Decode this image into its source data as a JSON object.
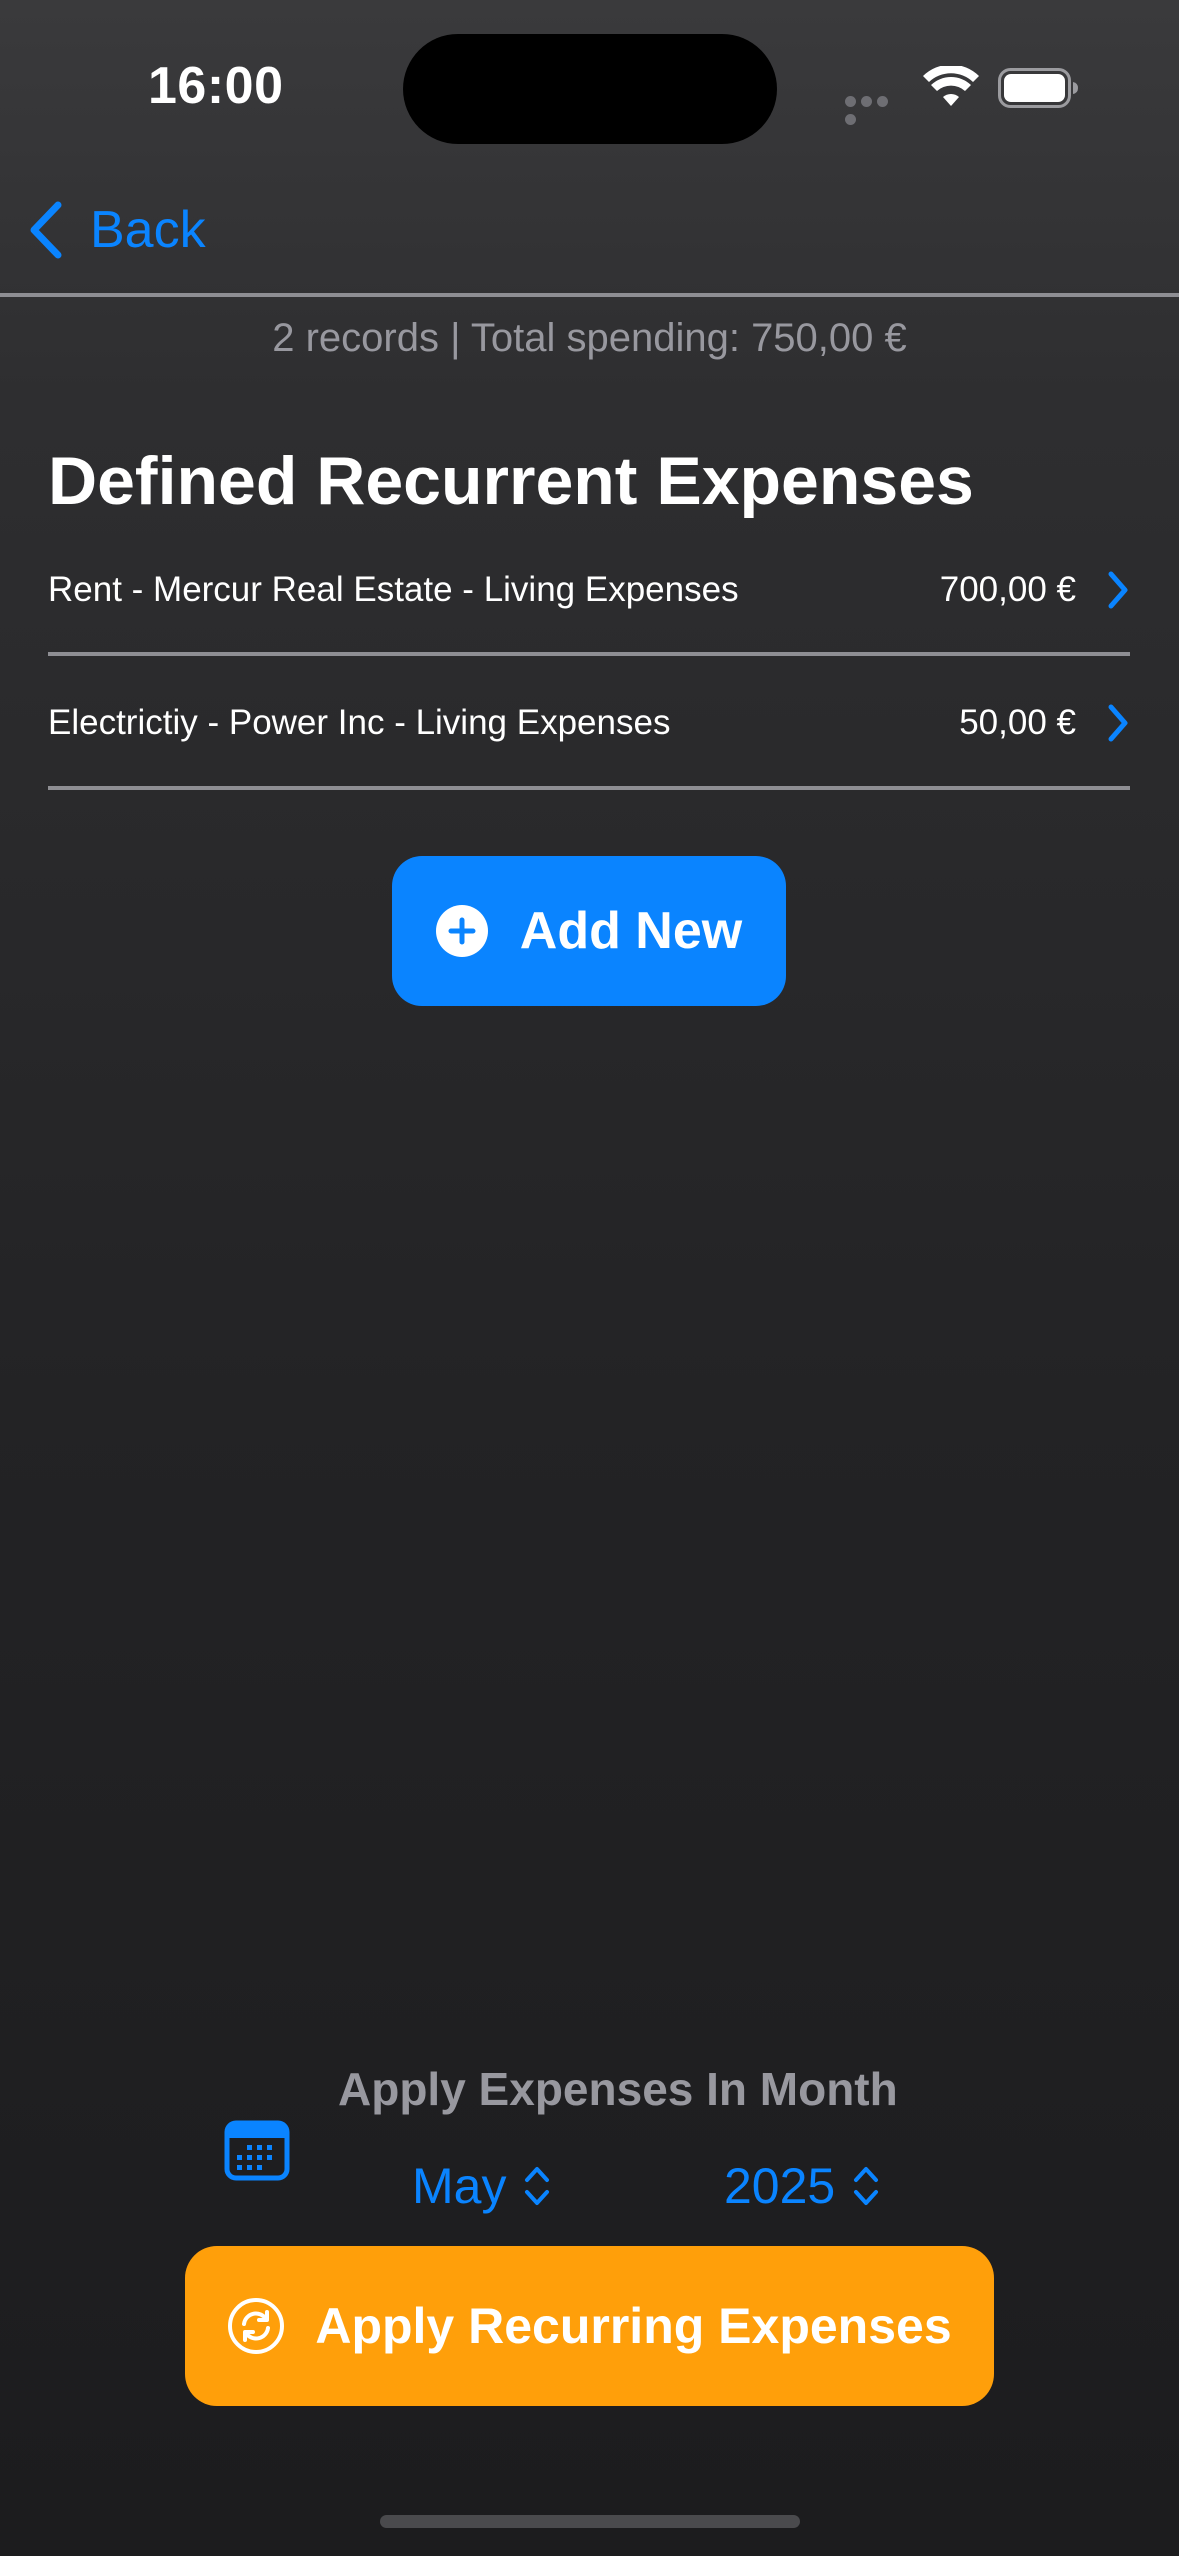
{
  "status_bar": {
    "time": "16:00",
    "icons": [
      "cellular-dots-icon",
      "wifi-icon",
      "battery-icon"
    ]
  },
  "nav": {
    "back_label": "Back",
    "back_icon": "chevron-left-icon"
  },
  "summary": "2 records | Total spending: 750,00 €",
  "section_title": "Defined Recurrent Expenses",
  "expenses": [
    {
      "label": "Rent - Mercur Real Estate - Living Expenses",
      "amount": "700,00 €"
    },
    {
      "label": "Electrictiy - Power Inc - Living Expenses",
      "amount": "50,00 €"
    }
  ],
  "add_button": {
    "label": "Add New",
    "icon": "plus-circle-icon"
  },
  "month_picker": {
    "title": "Apply Expenses In Month",
    "icon": "calendar-icon",
    "month": "May",
    "year": "2025"
  },
  "apply_button": {
    "label": "Apply Recurring Expenses",
    "icon": "refresh-circle-icon"
  },
  "colors": {
    "accent": "#0a84ff",
    "apply": "#ff9f0a",
    "secondary_text": "#98989f",
    "divider": "#8e8e93"
  }
}
